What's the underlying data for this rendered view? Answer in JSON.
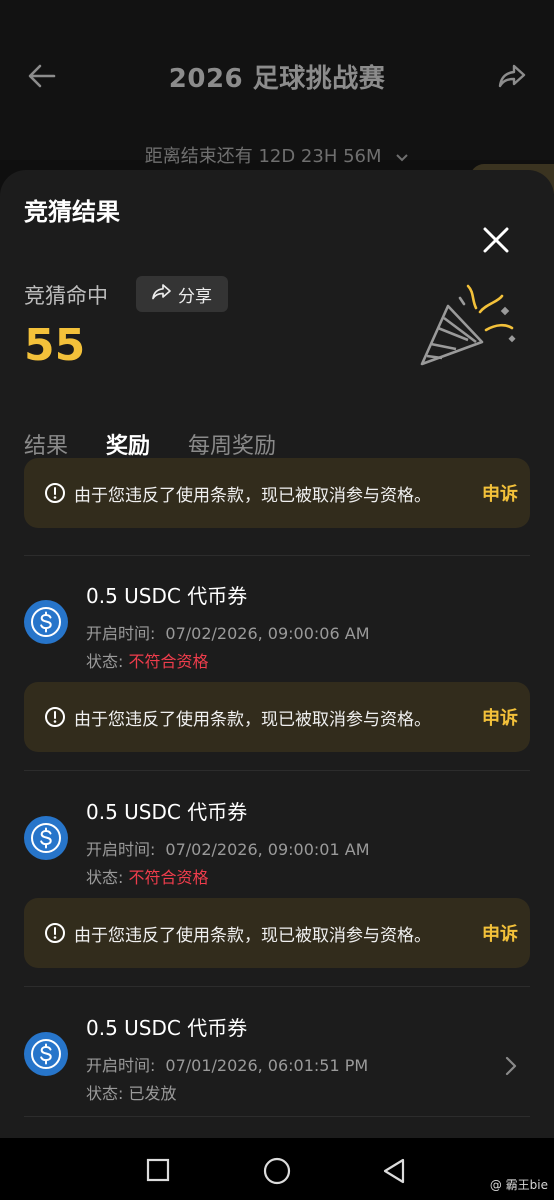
{
  "header": {
    "title": "2026 足球挑战赛",
    "countdown": "距离结束还有 12D 23H 56M"
  },
  "sheet": {
    "title": "竞猜结果",
    "hit_label": "竞猜命中",
    "share_label": "分享",
    "score": "55",
    "tabs": [
      {
        "label": "结果",
        "active": false
      },
      {
        "label": "奖励",
        "active": true
      },
      {
        "label": "每周奖励",
        "active": false
      }
    ]
  },
  "warning": {
    "text": "由于您违反了使用条款，现已被取消参与资格。",
    "appeal_label": "申诉"
  },
  "rewards": [
    {
      "title": "0.5 USDC 代币券",
      "time_label": "开启时间:",
      "time_value": "07/02/2026, 09:00:06 AM",
      "status_label": "状态:",
      "status_value": "不符合资格"
    },
    {
      "title": "0.5 USDC 代币券",
      "time_label": "开启时间:",
      "time_value": "07/02/2026, 09:00:01 AM",
      "status_label": "状态:",
      "status_value": "不符合资格"
    },
    {
      "title": "0.5 USDC 代币券",
      "time_label": "开启时间:",
      "time_value": "07/01/2026, 06:01:51 PM",
      "status_label": "状态:",
      "status_value": "已发放"
    }
  ],
  "watermark": "@ 霸王bie",
  "colors": {
    "accent": "#f3c13a",
    "danger": "#ef3d4c",
    "usdc": "#2775ca",
    "sheet_bg": "#1c1c1c",
    "warning_bg": "#322c1c"
  },
  "icons": [
    "back-arrow-icon",
    "share-icon",
    "chevron-down-icon",
    "close-icon",
    "party-popper-icon",
    "alert-circle-icon",
    "usdc-coin-icon",
    "chevron-right-icon"
  ]
}
